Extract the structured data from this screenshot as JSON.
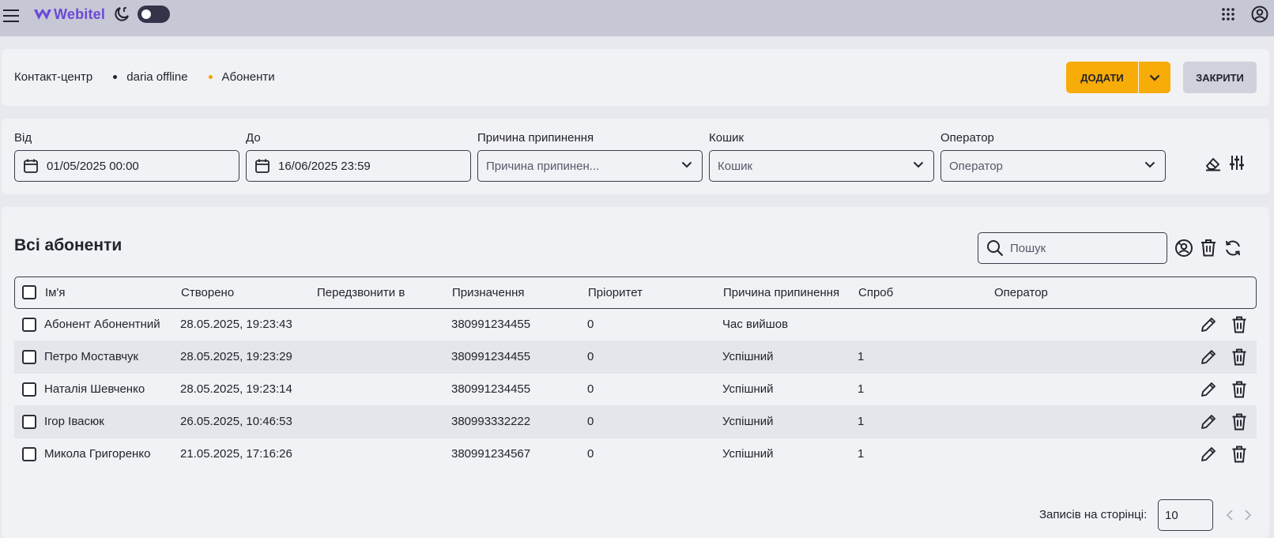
{
  "topbar": {
    "logo_text": "Webitel",
    "brand_color": "#6b4ad4",
    "icons": [
      "menu-icon",
      "moon-phone-icon",
      "theme-toggle",
      "apps-grid-icon",
      "account-circle-icon"
    ]
  },
  "breadcrumb": {
    "items": [
      "Контакт-центр",
      "daria offline",
      "Абоненти"
    ]
  },
  "actions": {
    "add_label": "ДОДАТИ",
    "close_label": "ЗАКРИТИ",
    "accent_color": "#f8ac08"
  },
  "filters": {
    "from": {
      "label": "Від",
      "value": "01/05/2025 00:00"
    },
    "to": {
      "label": "До",
      "value": "16/06/2025 23:59"
    },
    "reason": {
      "label": "Причина припинення",
      "placeholder": "Причина припинен..."
    },
    "bucket": {
      "label": "Кошик",
      "placeholder": "Кошик"
    },
    "operator": {
      "label": "Оператор",
      "placeholder": "Оператор"
    }
  },
  "table": {
    "title": "Всі абоненти",
    "search_placeholder": "Пошук",
    "columns": [
      "Ім'я",
      "Створено",
      "Передзвонити в",
      "Призначення",
      "Пріоритет",
      "Причина припинення",
      "Спроб",
      "Оператор"
    ],
    "rows": [
      {
        "name": "Абонент Абонентний",
        "created": "28.05.2025, 19:23:43",
        "callback": "",
        "destination": "380991234455",
        "priority": "0",
        "reason": "Час вийшов",
        "attempts": "",
        "operator": ""
      },
      {
        "name": "Петро Моставчук",
        "created": "28.05.2025, 19:23:29",
        "callback": "",
        "destination": "380991234455",
        "priority": "0",
        "reason": "Успішний",
        "attempts": "1",
        "operator": ""
      },
      {
        "name": "Наталія Шевченко",
        "created": "28.05.2025, 19:23:14",
        "callback": "",
        "destination": "380991234455",
        "priority": "0",
        "reason": "Успішний",
        "attempts": "1",
        "operator": ""
      },
      {
        "name": "Ігор Івасюк",
        "created": "26.05.2025, 10:46:53",
        "callback": "",
        "destination": "380993332222",
        "priority": "0",
        "reason": "Успішний",
        "attempts": "1",
        "operator": ""
      },
      {
        "name": "Микола Григоренко",
        "created": "21.05.2025, 17:16:26",
        "callback": "",
        "destination": "380991234567",
        "priority": "0",
        "reason": "Успішний",
        "attempts": "1",
        "operator": ""
      }
    ]
  },
  "pagination": {
    "per_page_label": "Записів на сторінці:",
    "per_page_value": "10"
  }
}
